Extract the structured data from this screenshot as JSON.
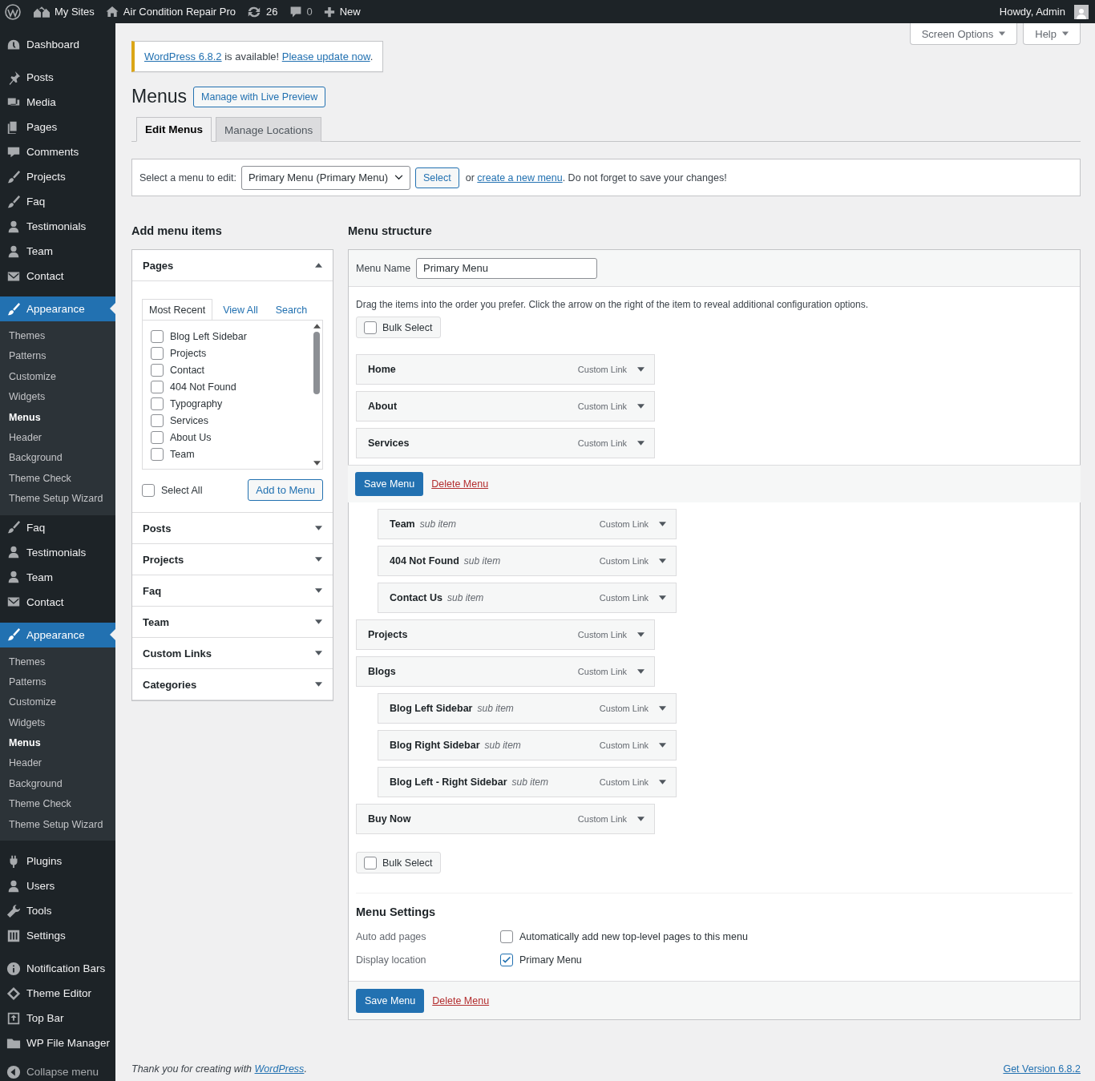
{
  "admin_bar": {
    "items": [
      {
        "label": "My Sites"
      },
      {
        "label": "Air Condition Repair Pro"
      },
      {
        "label": "26"
      },
      {
        "label": "0"
      },
      {
        "label": "New"
      }
    ],
    "account": "Howdy, Admin"
  },
  "sidebar": {
    "sections": [
      {
        "items": [
          {
            "label": "Dashboard",
            "selected": false
          }
        ]
      },
      {
        "items": [
          {
            "label": "Posts",
            "selected": false
          },
          {
            "label": "Media",
            "selected": false
          },
          {
            "label": "Pages",
            "selected": false
          },
          {
            "label": "Comments",
            "selected": false
          },
          {
            "label": "Projects",
            "selected": false
          },
          {
            "label": "Faq",
            "selected": false
          },
          {
            "label": "Testimonials",
            "selected": false
          },
          {
            "label": "Team",
            "selected": false
          },
          {
            "label": "Contact",
            "selected": false
          }
        ]
      },
      {
        "items": [
          {
            "label": "Appearance",
            "selected": true,
            "children": [
              {
                "label": "Themes",
                "selected": false
              },
              {
                "label": "Patterns",
                "selected": false
              },
              {
                "label": "Customize",
                "selected": false
              },
              {
                "label": "Widgets",
                "selected": false
              },
              {
                "label": "Menus",
                "selected": true
              },
              {
                "label": "Header",
                "selected": false
              },
              {
                "label": "Background",
                "selected": false
              },
              {
                "label": "Theme Check",
                "selected": false
              },
              {
                "label": "Theme Setup Wizard",
                "selected": false
              }
            ]
          },
          {
            "label": "Faq",
            "selected": false
          },
          {
            "label": "Testimonials",
            "selected": false
          },
          {
            "label": "Team",
            "selected": false
          },
          {
            "label": "Contact",
            "selected": false
          }
        ]
      },
      {
        "items": [
          {
            "label": "Appearance",
            "selected": true,
            "children": [
              {
                "label": "Themes",
                "selected": false
              },
              {
                "label": "Patterns",
                "selected": false
              },
              {
                "label": "Customize",
                "selected": false
              },
              {
                "label": "Widgets",
                "selected": false
              },
              {
                "label": "Menus",
                "selected": true
              },
              {
                "label": "Header",
                "selected": false
              },
              {
                "label": "Background",
                "selected": false
              },
              {
                "label": "Theme Check",
                "selected": false
              },
              {
                "label": "Theme Setup Wizard",
                "selected": false
              }
            ]
          }
        ]
      },
      {
        "items": [
          {
            "label": "Plugins",
            "selected": false
          },
          {
            "label": "Users",
            "selected": false
          },
          {
            "label": "Tools",
            "selected": false
          },
          {
            "label": "Settings",
            "selected": false
          }
        ]
      },
      {
        "items": [
          {
            "label": "Notification Bars",
            "selected": false
          },
          {
            "label": "Theme Editor",
            "selected": false
          },
          {
            "label": "Top Bar",
            "selected": false
          },
          {
            "label": "WP File Manager",
            "selected": false
          }
        ]
      }
    ],
    "collapse": "Collapse menu"
  },
  "screen_meta": [
    "Screen Options",
    "Help"
  ],
  "notice": {
    "parts": [
      {
        "kind": "link",
        "text": "WordPress 6.8.2"
      },
      {
        "kind": "text",
        "text": " is available! "
      },
      {
        "kind": "link",
        "text": "Please update now"
      },
      {
        "kind": "text",
        "text": "."
      }
    ]
  },
  "page_title": "Menus",
  "live_preview": "Manage with Live Preview",
  "tabs": [
    {
      "label": "Edit Menus",
      "selected": true
    },
    {
      "label": "Manage Locations",
      "selected": false
    }
  ],
  "menu_select": {
    "label": "Select a menu to edit:",
    "value": "Primary Menu (Primary Menu)",
    "button": "Select",
    "parts": [
      {
        "kind": "text",
        "text": "or "
      },
      {
        "kind": "link",
        "text": "create a new menu"
      },
      {
        "kind": "text",
        "text": ". Do not forget to save your changes!"
      }
    ]
  },
  "add_items": {
    "title": "Add menu items",
    "panels": [
      {
        "title": "Pages",
        "expanded": true,
        "tabs": [
          {
            "label": "Most Recent",
            "selected": true
          },
          {
            "label": "View All",
            "selected": false
          },
          {
            "label": "Search",
            "selected": false
          }
        ],
        "items": [
          {
            "label": "Blog Left Sidebar",
            "checked": false
          },
          {
            "label": "Projects",
            "checked": false
          },
          {
            "label": "Contact",
            "checked": false
          },
          {
            "label": "404 Not Found",
            "checked": false
          },
          {
            "label": "Typography",
            "checked": false
          },
          {
            "label": "Services",
            "checked": false
          },
          {
            "label": "About Us",
            "checked": false
          },
          {
            "label": "Team",
            "checked": false
          }
        ],
        "select_all": {
          "label": "Select All",
          "checked": false
        },
        "add_button": "Add to Menu"
      },
      {
        "title": "Posts",
        "expanded": false
      },
      {
        "title": "Projects",
        "expanded": false
      },
      {
        "title": "Faq",
        "expanded": false
      },
      {
        "title": "Team",
        "expanded": false
      },
      {
        "title": "Custom Links",
        "expanded": false
      },
      {
        "title": "Categories",
        "expanded": false
      }
    ]
  },
  "structure": {
    "title": "Menu structure",
    "name_label": "Menu Name",
    "name_value": "Primary Menu",
    "instructions": "Drag the items into the order you prefer. Click the arrow on the right of the item to reveal additional configuration options.",
    "bulk_select_top": {
      "label": "Bulk Select",
      "checked": false
    },
    "items": [
      {
        "title": "Home",
        "type": "Custom Link"
      },
      {
        "title": "About",
        "type": "Custom Link"
      },
      {
        "title": "Services",
        "type": "Custom Link",
        "children": [
          {
            "title": "Team",
            "note": "sub item",
            "type": "Custom Link"
          },
          {
            "title": "404 Not Found",
            "note": "sub item",
            "type": "Custom Link"
          },
          {
            "title": "Contact Us",
            "note": "sub item",
            "type": "Custom Link"
          }
        ]
      },
      {
        "title": "Projects",
        "type": "Custom Link"
      },
      {
        "title": "Blogs",
        "type": "Custom Link",
        "children": [
          {
            "title": "Blog Left Sidebar",
            "note": "sub item",
            "type": "Custom Link"
          },
          {
            "title": "Blog Right Sidebar",
            "note": "sub item",
            "type": "Custom Link"
          },
          {
            "title": "Blog Left - Right Sidebar",
            "note": "sub item",
            "type": "Custom Link"
          }
        ]
      },
      {
        "title": "Buy Now",
        "type": "Custom Link"
      }
    ],
    "sticky_actions": {
      "save": "Save Menu",
      "delete": "Delete Menu"
    },
    "bulk_select_bottom": {
      "label": "Bulk Select",
      "checked": false
    },
    "settings": {
      "title": "Menu Settings",
      "rows": [
        {
          "label": "Auto add pages",
          "option": {
            "label": "Automatically add new top-level pages to this menu",
            "checked": false
          }
        },
        {
          "label": "Display location",
          "option": {
            "label": "Primary Menu",
            "checked": true
          }
        }
      ]
    },
    "footer_actions": {
      "save": "Save Menu",
      "delete": "Delete Menu"
    }
  },
  "footer": {
    "parts": [
      {
        "kind": "text",
        "text": "Thank you for creating with "
      },
      {
        "kind": "link",
        "text": "WordPress"
      },
      {
        "kind": "text",
        "text": "."
      }
    ],
    "version": "Get Version 6.8.2"
  }
}
